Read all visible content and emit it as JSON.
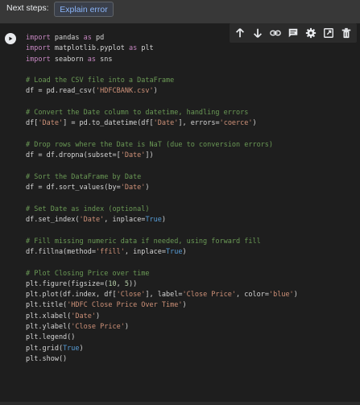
{
  "header": {
    "next_steps_label": "Next steps:",
    "explain_button_label": "Explain error"
  },
  "toolbar_icons": [
    "arrow-up-icon",
    "arrow-down-icon",
    "link-icon",
    "comment-icon",
    "gear-icon",
    "open-in-tab-icon",
    "trash-icon"
  ],
  "code_lines": [
    [
      {
        "t": "import",
        "c": "kw"
      },
      {
        "t": " pandas "
      },
      {
        "t": "as",
        "c": "kw"
      },
      {
        "t": " pd"
      }
    ],
    [
      {
        "t": "import",
        "c": "kw"
      },
      {
        "t": " matplotlib.pyplot "
      },
      {
        "t": "as",
        "c": "kw"
      },
      {
        "t": " plt"
      }
    ],
    [
      {
        "t": "import",
        "c": "kw"
      },
      {
        "t": " seaborn "
      },
      {
        "t": "as",
        "c": "kw"
      },
      {
        "t": " sns"
      }
    ],
    [],
    [
      {
        "t": "# Load the CSV file into a DataFrame",
        "c": "cm"
      }
    ],
    [
      {
        "t": "df = pd.read_csv("
      },
      {
        "t": "'HDFCBANK.csv'",
        "c": "st"
      },
      {
        "t": ")"
      }
    ],
    [],
    [
      {
        "t": "# Convert the Date column to datetime, handling errors",
        "c": "cm"
      }
    ],
    [
      {
        "t": "df["
      },
      {
        "t": "'Date'",
        "c": "st"
      },
      {
        "t": "] = pd.to_datetime(df["
      },
      {
        "t": "'Date'",
        "c": "st"
      },
      {
        "t": "], errors="
      },
      {
        "t": "'coerce'",
        "c": "st"
      },
      {
        "t": ")"
      }
    ],
    [],
    [
      {
        "t": "# Drop rows where the Date is NaT (due to conversion errors)",
        "c": "cm"
      }
    ],
    [
      {
        "t": "df = df.dropna(subset=["
      },
      {
        "t": "'Date'",
        "c": "st"
      },
      {
        "t": "])"
      }
    ],
    [],
    [
      {
        "t": "# Sort the DataFrame by Date",
        "c": "cm"
      }
    ],
    [
      {
        "t": "df = df.sort_values(by="
      },
      {
        "t": "'Date'",
        "c": "st"
      },
      {
        "t": ")"
      }
    ],
    [],
    [
      {
        "t": "# Set Date as index (optional)",
        "c": "cm"
      }
    ],
    [
      {
        "t": "df.set_index("
      },
      {
        "t": "'Date'",
        "c": "st"
      },
      {
        "t": ", inplace="
      },
      {
        "t": "True",
        "c": "bl"
      },
      {
        "t": ")"
      }
    ],
    [],
    [
      {
        "t": "# Fill missing numeric data if needed, using forward fill",
        "c": "cm"
      }
    ],
    [
      {
        "t": "df.fillna(method="
      },
      {
        "t": "'ffill'",
        "c": "st"
      },
      {
        "t": ", inplace="
      },
      {
        "t": "True",
        "c": "bl"
      },
      {
        "t": ")"
      }
    ],
    [],
    [
      {
        "t": "# Plot Closing Price over time",
        "c": "cm"
      }
    ],
    [
      {
        "t": "plt.figure(figsize=("
      },
      {
        "t": "10",
        "c": "num"
      },
      {
        "t": ", "
      },
      {
        "t": "5",
        "c": "num"
      },
      {
        "t": "))"
      }
    ],
    [
      {
        "t": "plt.plot(df.index, df["
      },
      {
        "t": "'Close'",
        "c": "st"
      },
      {
        "t": "], label="
      },
      {
        "t": "'Close Price'",
        "c": "st"
      },
      {
        "t": ", color="
      },
      {
        "t": "'blue'",
        "c": "st"
      },
      {
        "t": ")"
      }
    ],
    [
      {
        "t": "plt.title("
      },
      {
        "t": "'HDFC Close Price Over Time'",
        "c": "st"
      },
      {
        "t": ")"
      }
    ],
    [
      {
        "t": "plt.xlabel("
      },
      {
        "t": "'Date'",
        "c": "st"
      },
      {
        "t": ")"
      }
    ],
    [
      {
        "t": "plt.ylabel("
      },
      {
        "t": "'Close Price'",
        "c": "st"
      },
      {
        "t": ")"
      }
    ],
    [
      {
        "t": "plt.legend()"
      }
    ],
    [
      {
        "t": "plt.grid("
      },
      {
        "t": "True",
        "c": "bl"
      },
      {
        "t": ")"
      }
    ],
    [
      {
        "t": "plt.show()"
      }
    ]
  ]
}
